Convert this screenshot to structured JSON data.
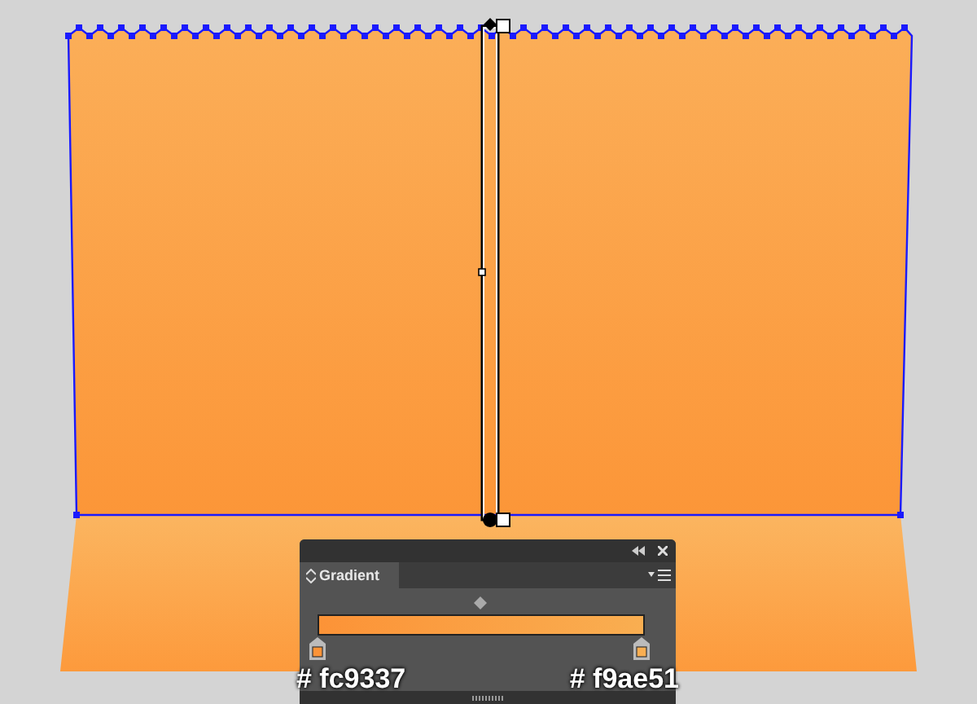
{
  "panel": {
    "title": "Gradient",
    "tab_selected": true
  },
  "stops": [
    {
      "color": "#fc9337",
      "label": "# fc9337"
    },
    {
      "color": "#f9ae51",
      "label": "# f9ae51"
    }
  ]
}
